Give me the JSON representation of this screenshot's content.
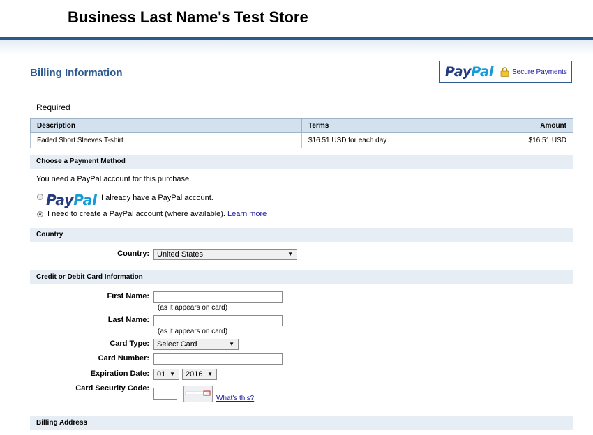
{
  "header": {
    "store_title": "Business Last Name's Test Store"
  },
  "billing": {
    "heading": "Billing Information"
  },
  "paypal_badge": {
    "logo_part1": "Pay",
    "logo_part2": "Pal",
    "secure_text": "Secure Payments"
  },
  "required_label": "Required",
  "items_table": {
    "headers": [
      "Description",
      "Terms",
      "Amount"
    ],
    "rows": [
      {
        "description": "Faded Short Sleeves T-shirt",
        "terms": "$16.51 USD for each day",
        "amount": "$16.51 USD"
      }
    ]
  },
  "payment_method": {
    "section_title": "Choose a Payment Method",
    "note": "You need a PayPal account for this purchase.",
    "option_existing": {
      "logo_part1": "Pay",
      "logo_part2": "Pal",
      "label": "I already have a PayPal account.",
      "selected": false
    },
    "option_create": {
      "label": "I need to create a PayPal account (where available).",
      "link": "Learn more",
      "selected": true
    }
  },
  "country": {
    "section_title": "Country",
    "label": "Country:",
    "value": "United States"
  },
  "card": {
    "section_title": "Credit or Debit Card Information",
    "first_name_label": "First Name:",
    "first_name_hint": "(as it appears on card)",
    "last_name_label": "Last Name:",
    "last_name_hint": "(as it appears on card)",
    "card_type_label": "Card Type:",
    "card_type_value": "Select Card",
    "card_number_label": "Card Number:",
    "expiration_label": "Expiration Date:",
    "exp_month": "01",
    "exp_year": "2016",
    "csc_label": "Card Security Code:",
    "csc_link": "What's this?"
  },
  "billing_address": {
    "section_title": "Billing Address"
  },
  "colors": {
    "accent": "#2c5a8c",
    "section_bg": "#e6edf5",
    "table_header_bg": "#d3e1ef"
  }
}
